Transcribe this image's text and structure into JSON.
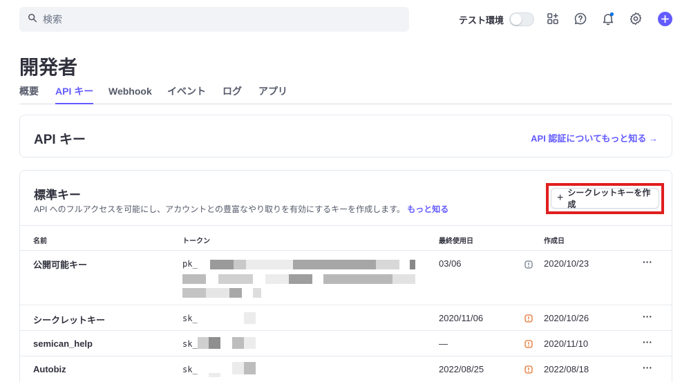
{
  "search": {
    "placeholder": "検索"
  },
  "topbar": {
    "test_env_label": "テスト環境",
    "icons": [
      "apps-icon",
      "help-icon",
      "bell-icon",
      "gear-icon",
      "plus-icon"
    ],
    "accent": "#635bff"
  },
  "page": {
    "title": "開発者",
    "tabs": [
      {
        "label": "概要",
        "active": false
      },
      {
        "label": "API キー",
        "active": true
      },
      {
        "label": "Webhook",
        "active": false
      },
      {
        "label": "イベント",
        "active": false
      },
      {
        "label": "ログ",
        "active": false
      },
      {
        "label": "アプリ",
        "active": false
      }
    ]
  },
  "api_card": {
    "title": "API キー",
    "link": "API 認証についてもっと知る →"
  },
  "standard": {
    "title": "標準キー",
    "description": "API へのフルアクセスを可能にし、アカウントとの豊富なやり取りを有効にするキーを作成します。",
    "more_link": "もっと知る",
    "create_button": "シークレットキーを作成",
    "highlight_color": "#e01e1e"
  },
  "table": {
    "headers": {
      "name": "名前",
      "token": "トークン",
      "last_used": "最終使用日",
      "created": "作成日"
    },
    "rows": [
      {
        "name": "公開可能キー",
        "token_prefix": "pk_",
        "last_used": "03/06",
        "status": "info",
        "created": "2020/10/23",
        "menu": "···"
      },
      {
        "name": "シークレットキー",
        "token_prefix": "sk_",
        "last_used": "2020/11/06",
        "status": "warning",
        "created": "2020/10/26",
        "menu": "···"
      },
      {
        "name": "semican_help",
        "token_prefix": "sk_",
        "last_used": "—",
        "status": "warning",
        "created": "2020/11/10",
        "menu": "···"
      },
      {
        "name": "Autobiz",
        "token_prefix": "sk_",
        "last_used": "2022/08/25",
        "status": "warning",
        "created": "2022/08/18",
        "menu": "···"
      }
    ]
  }
}
